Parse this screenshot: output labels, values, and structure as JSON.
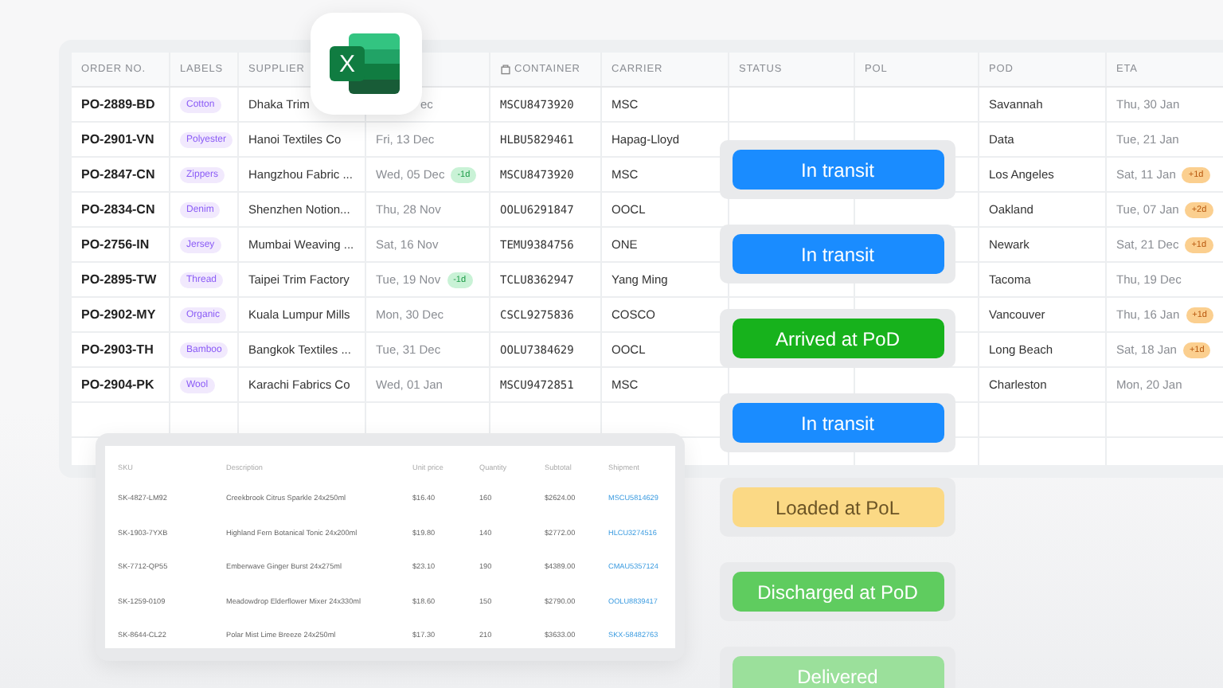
{
  "orders": {
    "columns": [
      "ORDER NO.",
      "LABELS",
      "SUPPLIER",
      "",
      "CONTAINER",
      "CARRIER",
      "STATUS",
      "POL",
      "POD",
      "ETA"
    ],
    "rows": [
      {
        "order": "PO-2889-BD",
        "label": "Cotton",
        "supplier": "Dhaka Trim",
        "date": "ec",
        "container": "MSCU8473920",
        "carrier": "MSC",
        "pod": "Savannah",
        "eta": "Thu, 30 Jan"
      },
      {
        "order": "PO-2901-VN",
        "label": "Polyester",
        "supplier": "Hanoi Textiles Co",
        "date": "Fri, 13 Dec",
        "container": "HLBU5829461",
        "carrier": "Hapag-Lloyd",
        "pod": "Data",
        "eta": "Tue, 21 Jan"
      },
      {
        "order": "PO-2847-CN",
        "label": "Zippers",
        "supplier": "Hangzhou Fabric ...",
        "date": "Wed, 05 Dec",
        "date_badge": "-1d",
        "container": "MSCU8473920",
        "carrier": "MSC",
        "pod": "Los Angeles",
        "eta": "Sat, 11 Jan",
        "eta_badge": "+1d"
      },
      {
        "order": "PO-2834-CN",
        "label": "Denim",
        "supplier": "Shenzhen Notion...",
        "date": "Thu, 28 Nov",
        "container": "OOLU6291847",
        "carrier": "OOCL",
        "pod": "Oakland",
        "eta": "Tue, 07 Jan",
        "eta_badge": "+2d"
      },
      {
        "order": "PO-2756-IN",
        "label": "Jersey",
        "supplier": "Mumbai Weaving ...",
        "date": "Sat, 16 Nov",
        "container": "TEMU9384756",
        "carrier": "ONE",
        "pod": "Newark",
        "eta": "Sat, 21 Dec",
        "eta_badge": "+1d"
      },
      {
        "order": "PO-2895-TW",
        "label": "Thread",
        "supplier": "Taipei Trim Factory",
        "date": "Tue, 19 Nov",
        "date_badge": "-1d",
        "container": "TCLU8362947",
        "carrier": "Yang Ming",
        "pod": "Tacoma",
        "eta": "Thu, 19 Dec"
      },
      {
        "order": "PO-2902-MY",
        "label": "Organic",
        "supplier": "Kuala Lumpur Mills",
        "date": "Mon, 30 Dec",
        "container": "CSCL9275836",
        "carrier": "COSCO",
        "pod": "Vancouver",
        "eta": "Thu, 16 Jan",
        "eta_badge": "+1d"
      },
      {
        "order": "PO-2903-TH",
        "label": "Bamboo",
        "supplier": "Bangkok Textiles ...",
        "date": "Tue, 31 Dec",
        "container": "OOLU7384629",
        "carrier": "OOCL",
        "pod": "Long Beach",
        "eta": "Sat, 18 Jan",
        "eta_badge": "+1d"
      },
      {
        "order": "PO-2904-PK",
        "label": "Wool",
        "supplier": "Karachi Fabrics Co",
        "date": "Wed, 01 Jan",
        "container": "MSCU9472851",
        "carrier": "MSC",
        "pod": "Charleston",
        "eta": "Mon, 20 Jan"
      }
    ]
  },
  "app_icon": {
    "letter": "X"
  },
  "statuses": [
    {
      "kind": "transit",
      "text": "In transit"
    },
    {
      "kind": "transit",
      "text": "In transit"
    },
    {
      "kind": "arrived",
      "text": "Arrived at PoD"
    },
    {
      "kind": "transit",
      "text": "In transit"
    },
    {
      "kind": "loaded",
      "text": "Loaded at PoL"
    },
    {
      "kind": "discharged",
      "text": "Discharged at PoD"
    },
    {
      "kind": "delivered",
      "text": "Delivered"
    }
  ],
  "lines": {
    "columns": [
      "SKU",
      "Description",
      "Unit price",
      "Quantity",
      "Subtotal",
      "Shipment"
    ],
    "rows": [
      [
        "SK-4827-LM92",
        "Creekbrook Citrus Sparkle 24x250ml",
        "$16.40",
        "160",
        "$2624.00",
        "MSCU5814629"
      ],
      [
        "SK-1903-7YXB",
        "Highland Fern Botanical Tonic 24x200ml",
        "$19.80",
        "140",
        "$2772.00",
        "HLCU3274516"
      ],
      [
        "SK-7712-QP55",
        "Emberwave Ginger Burst 24x275ml",
        "$23.10",
        "190",
        "$4389.00",
        "CMAU5357124"
      ],
      [
        "SK-1259-0109",
        "Meadowdrop Elderflower Mixer 24x330ml",
        "$18.60",
        "150",
        "$2790.00",
        "OOLU8839417"
      ],
      [
        "SK-8644-CL22",
        "Polar Mist Lime Breeze 24x250ml",
        "$17.30",
        "210",
        "$3633.00",
        "SKX-58482763"
      ]
    ]
  }
}
